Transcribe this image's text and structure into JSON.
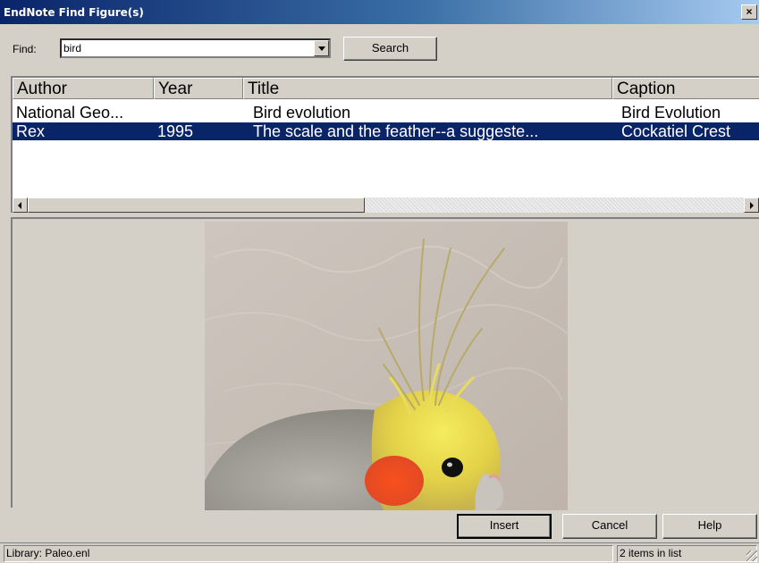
{
  "window": {
    "title": "EndNote Find Figure(s)",
    "close_label": "×"
  },
  "find": {
    "label": "Find:",
    "value": "bird",
    "search_label": "Search"
  },
  "list": {
    "columns": [
      "Author",
      "Year",
      "Title",
      "Caption"
    ],
    "rows": [
      {
        "author": "National Geo...",
        "year": "",
        "title": "Bird evolution",
        "caption": "Bird Evolution",
        "selected": false
      },
      {
        "author": "Rex",
        "year": "1995",
        "title": "The scale and the feather--a suggeste...",
        "caption": "Cockatiel Crest",
        "selected": true
      }
    ]
  },
  "preview": {
    "image": "cockatiel-photo"
  },
  "buttons": {
    "insert": "Insert",
    "cancel": "Cancel",
    "help": "Help"
  },
  "status": {
    "library": "Library: Paleo.enl",
    "count": "2 items in list"
  },
  "colors": {
    "titlebar": "#0a246a",
    "selection": "#0a246a",
    "face": "#d4d0c8"
  }
}
